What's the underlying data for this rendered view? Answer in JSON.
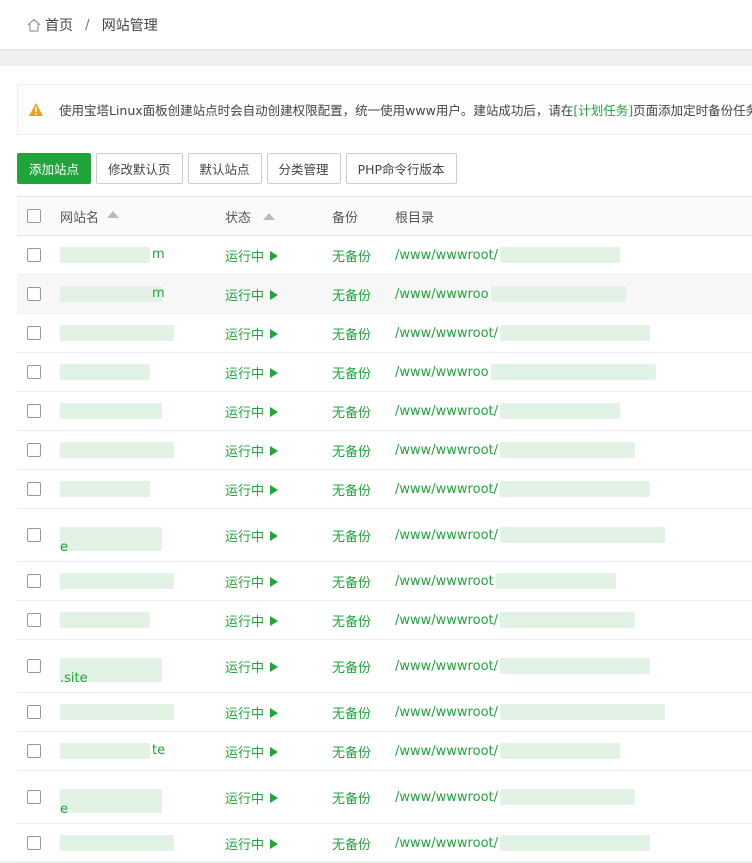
{
  "breadcrumb": {
    "home": "首页",
    "separator": "/",
    "current": "网站管理"
  },
  "notice": {
    "text_before": "使用宝塔Linux面板创建站点时会自动创建权限配置，统一使用www用户。建站成功后，请在",
    "link": "[计划任务]",
    "text_after": "页面添加定时备份任务！"
  },
  "toolbar": {
    "add_site": "添加站点",
    "modify_default_page": "修改默认页",
    "default_site": "默认站点",
    "category_manage": "分类管理",
    "php_cli_version": "PHP命令行版本"
  },
  "table": {
    "headers": {
      "name": "网站名",
      "status": "状态",
      "backup": "备份",
      "root": "根目录"
    },
    "rows": [
      {
        "name": "m",
        "status": "运行中",
        "backup": "无备份",
        "path": "/www/wwwroot/"
      },
      {
        "name": "m",
        "status": "运行中",
        "backup": "无备份",
        "path": "/www/wwwroo"
      },
      {
        "name": "",
        "status": "运行中",
        "backup": "无备份",
        "path": "/www/wwwroot/"
      },
      {
        "name": "",
        "status": "运行中",
        "backup": "无备份",
        "path": "/www/wwwroo"
      },
      {
        "name": "",
        "status": "运行中",
        "backup": "无备份",
        "path": "/www/wwwroot/"
      },
      {
        "name": "",
        "status": "运行中",
        "backup": "无备份",
        "path": "/www/wwwroot/"
      },
      {
        "name": "",
        "status": "运行中",
        "backup": "无备份",
        "path": "/www/wwwroot/"
      },
      {
        "name": "e",
        "status": "运行中",
        "backup": "无备份",
        "path": "/www/wwwroot/"
      },
      {
        "name": "",
        "status": "运行中",
        "backup": "无备份",
        "path": "/www/wwwroot"
      },
      {
        "name": "",
        "status": "运行中",
        "backup": "无备份",
        "path": "/www/wwwroot/"
      },
      {
        "name": ".site",
        "status": "运行中",
        "backup": "无备份",
        "path": "/www/wwwroot/"
      },
      {
        "name": "",
        "status": "运行中",
        "backup": "无备份",
        "path": "/www/wwwroot/"
      },
      {
        "name": "te",
        "status": "运行中",
        "backup": "无备份",
        "path": "/www/wwwroot/"
      },
      {
        "name": "e",
        "status": "运行中",
        "backup": "无备份",
        "path": "/www/wwwroot/"
      },
      {
        "name": "",
        "status": "运行中",
        "backup": "无备份",
        "path": "/www/wwwroot/"
      }
    ]
  },
  "colors": {
    "accent": "#20a53a",
    "warning": "#f0a020"
  },
  "icons": {
    "home": "home-icon",
    "warning": "warning-icon",
    "sort": "sort-icon",
    "status": "play-icon"
  }
}
